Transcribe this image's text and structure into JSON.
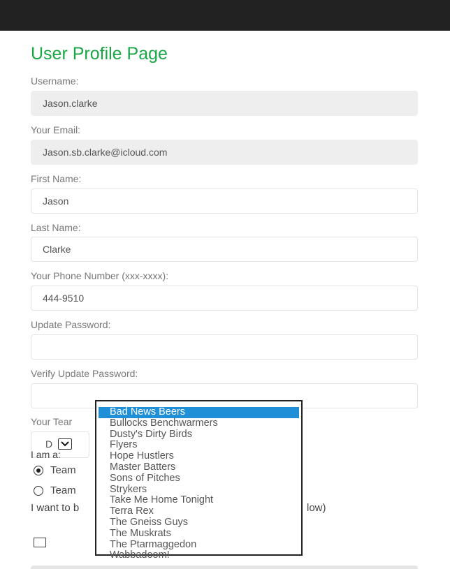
{
  "page": {
    "title": "User Profile Page"
  },
  "fields": {
    "username": {
      "label": "Username:",
      "value": "Jason.clarke"
    },
    "email": {
      "label": "Your Email:",
      "value": "Jason.sb.clarke@icloud.com"
    },
    "first_name": {
      "label": "First Name:",
      "value": "Jason"
    },
    "last_name": {
      "label": "Last Name:",
      "value": "Clarke"
    },
    "phone": {
      "label": "Your Phone Number (xxx-xxxx):",
      "value": "444-9510"
    },
    "password": {
      "label": "Update Password:",
      "value": ""
    },
    "verify_password": {
      "label": "Verify Update Password:",
      "value": ""
    }
  },
  "team": {
    "label_visible": "Your Tear",
    "selected_visible": "D"
  },
  "role": {
    "label": "I am a:",
    "options": [
      {
        "label_visible": "Team",
        "checked": true
      },
      {
        "label_visible": "Team",
        "checked": false
      }
    ]
  },
  "want": {
    "label_left": "I want to b",
    "label_right": "low)",
    "checked": false
  },
  "dropdown": {
    "selected_index": 0,
    "options": [
      "Bad News Beers",
      "Bullocks Benchwarmers",
      "Dusty's Dirty Birds",
      "Flyers",
      "Hope Hustlers",
      "Master Batters",
      "Sons of Pitches",
      "Strykers",
      "Take Me Home Tonight",
      "Terra Rex",
      "The Gneiss Guys",
      "The Muskrats",
      "The Ptarmaggedon",
      "Wabbadoom!"
    ]
  },
  "colors": {
    "title": "#1aa646",
    "navbar": "#222222",
    "selected_option": "#1f8fd8"
  }
}
